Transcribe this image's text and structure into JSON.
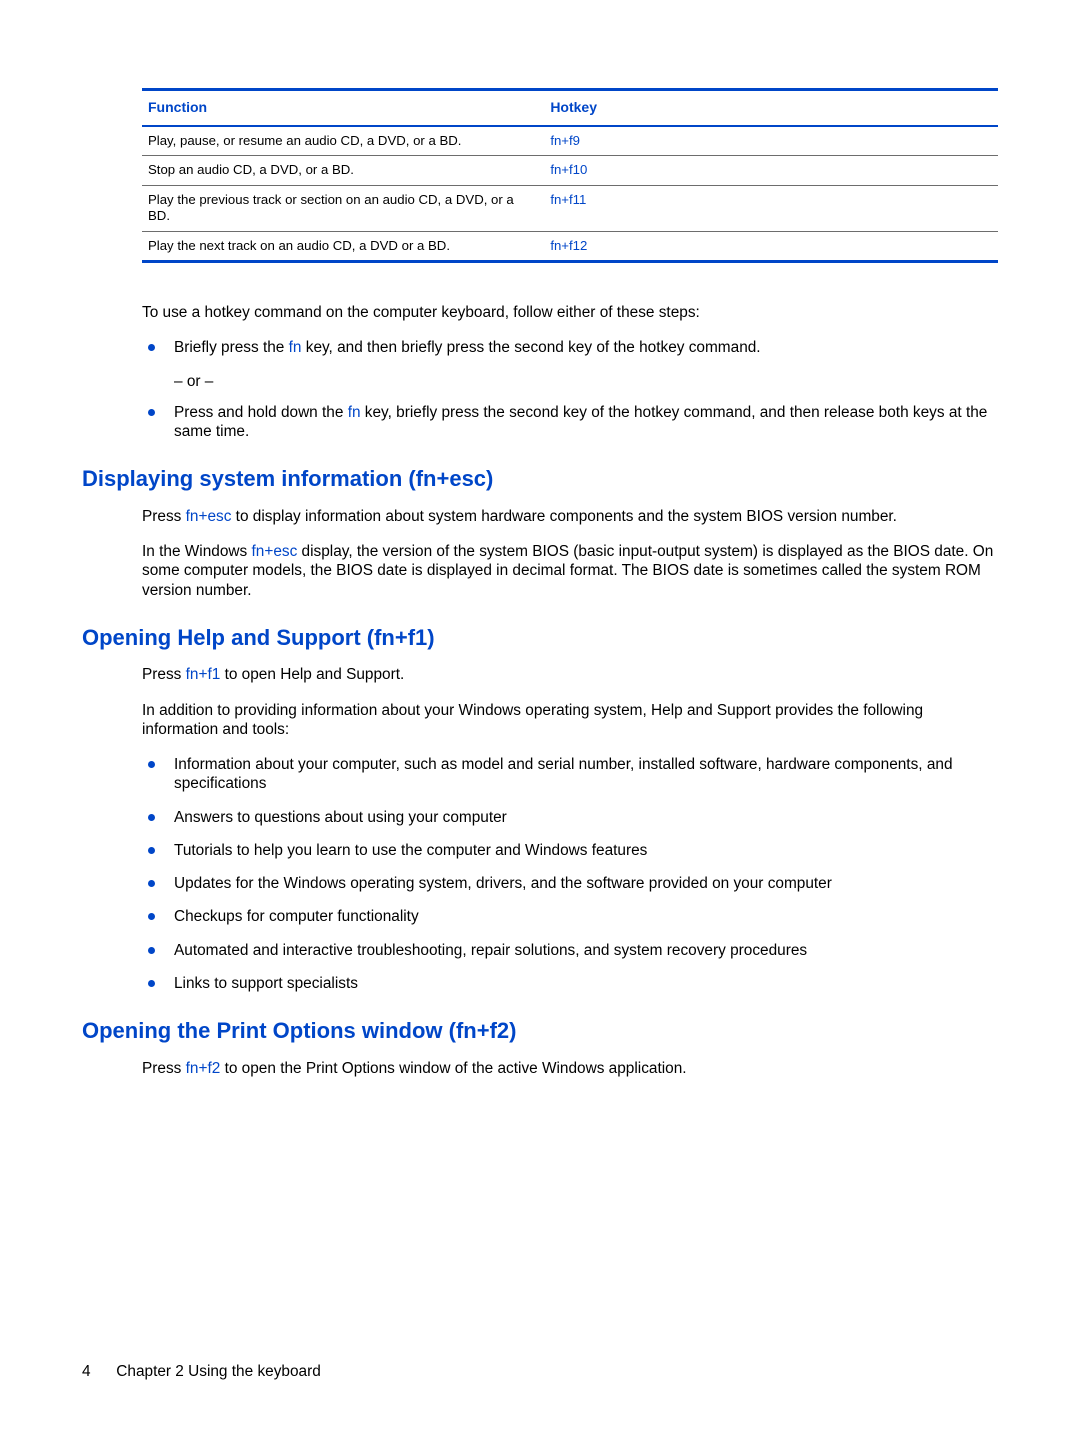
{
  "table": {
    "header": {
      "function": "Function",
      "hotkey": "Hotkey"
    },
    "rows": [
      {
        "function": "Play, pause, or resume an audio CD, a DVD, or a BD.",
        "hotkey": "fn+f9"
      },
      {
        "function": "Stop an audio CD, a DVD, or a BD.",
        "hotkey": "fn+f10"
      },
      {
        "function": "Play the previous track or section on an audio CD, a DVD, or a BD.",
        "hotkey": "fn+f11"
      },
      {
        "function": "Play the next track on an audio CD, a DVD or a BD.",
        "hotkey": "fn+f12"
      }
    ]
  },
  "intro": "To use a hotkey command on the computer keyboard, follow either of these steps:",
  "bullets_intro": [
    {
      "pre": "Briefly press the ",
      "fn": "fn",
      "post": " key, and then briefly press the second key of the hotkey command.",
      "sub": "– or –"
    },
    {
      "pre": "Press and hold down the ",
      "fn": "fn",
      "post": " key, briefly press the second key of the hotkey command, and then release both keys at the same time."
    }
  ],
  "sections": {
    "sysinfo": {
      "title": "Displaying system information (fn+esc)",
      "p1_pre": "Press ",
      "p1_key": "fn+esc",
      "p1_post": " to display information about system hardware components and the system BIOS version number.",
      "p2_pre": "In the Windows ",
      "p2_key": "fn+esc",
      "p2_post": " display, the version of the system BIOS (basic input-output system) is displayed as the BIOS date. On some computer models, the BIOS date is displayed in decimal format. The BIOS date is sometimes called the system ROM version number."
    },
    "help": {
      "title": "Opening Help and Support (fn+f1)",
      "p1_pre": "Press ",
      "p1_key": "fn+f1",
      "p1_post": " to open Help and Support.",
      "p2": "In addition to providing information about your Windows operating system, Help and Support provides the following information and tools:",
      "items": [
        "Information about your computer, such as model and serial number, installed software, hardware components, and specifications",
        "Answers to questions about using your computer",
        "Tutorials to help you learn to use the computer and Windows features",
        "Updates for the Windows operating system, drivers, and the software provided on your computer",
        "Checkups for computer functionality",
        "Automated and interactive troubleshooting, repair solutions, and system recovery procedures",
        "Links to support specialists"
      ]
    },
    "print": {
      "title": "Opening the Print Options window (fn+f2)",
      "p1_pre": "Press ",
      "p1_key": "fn+f2",
      "p1_post": " to open the Print Options window of the active Windows application."
    }
  },
  "footer": {
    "page": "4",
    "chapter": "Chapter 2   Using the keyboard"
  }
}
